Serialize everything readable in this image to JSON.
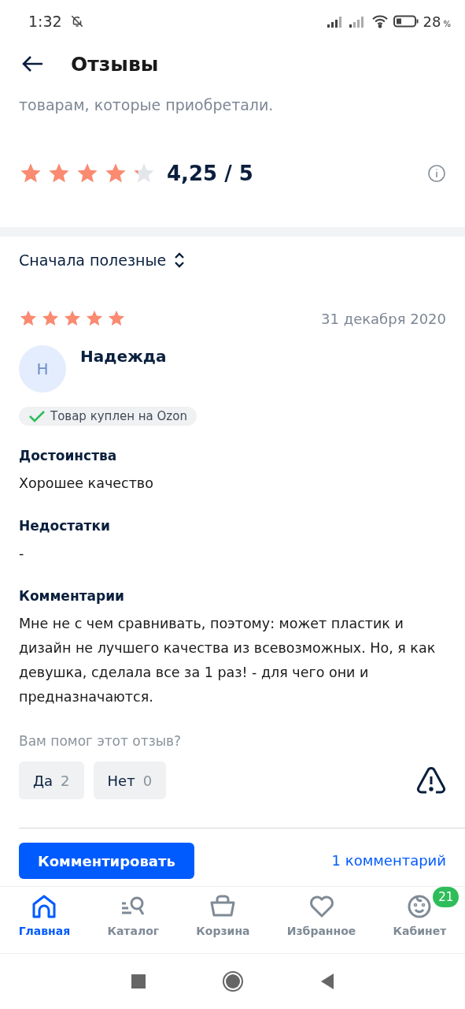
{
  "status_bar": {
    "time": "1:32",
    "battery": "28",
    "battery_unit": "%"
  },
  "header": {
    "title": "Отзывы"
  },
  "intro": {
    "text": "товарам, которые приобретали."
  },
  "summary": {
    "stars": 4.25,
    "score": "4,25 / 5"
  },
  "sort": {
    "label": "Сначала полезные"
  },
  "review": {
    "stars": 5,
    "date": "31 декабря 2020",
    "avatar_letter": "Н",
    "author": "Надежда",
    "badge": "Товар куплен на Ozon",
    "sections": [
      {
        "heading": "Достоинства",
        "text": "Хорошее качество"
      },
      {
        "heading": "Недостатки",
        "text": "-"
      },
      {
        "heading": "Комментарии",
        "text": "Мне не с чем сравнивать, поэтому: может пластик и дизайн не лучшего качества из всевозможных. Но, я как девушка, сделала все за 1 раз! - для чего они и предназначаются."
      }
    ],
    "helpful_question": "Вам помог этот отзыв?",
    "votes": [
      {
        "label": "Да",
        "count": "2"
      },
      {
        "label": "Нет",
        "count": "0"
      }
    ],
    "comment_button": "Комментировать",
    "comments_link": "1 комментарий"
  },
  "tab_bar": [
    {
      "label": "Главная",
      "kind": "home",
      "selected": true
    },
    {
      "label": "Каталог",
      "kind": "catalog",
      "selected": false
    },
    {
      "label": "Корзина",
      "kind": "basket",
      "selected": false
    },
    {
      "label": "Избранное",
      "kind": "favorites",
      "selected": false
    },
    {
      "label": "Кабинет",
      "kind": "profile",
      "selected": false,
      "badge": "21"
    }
  ]
}
